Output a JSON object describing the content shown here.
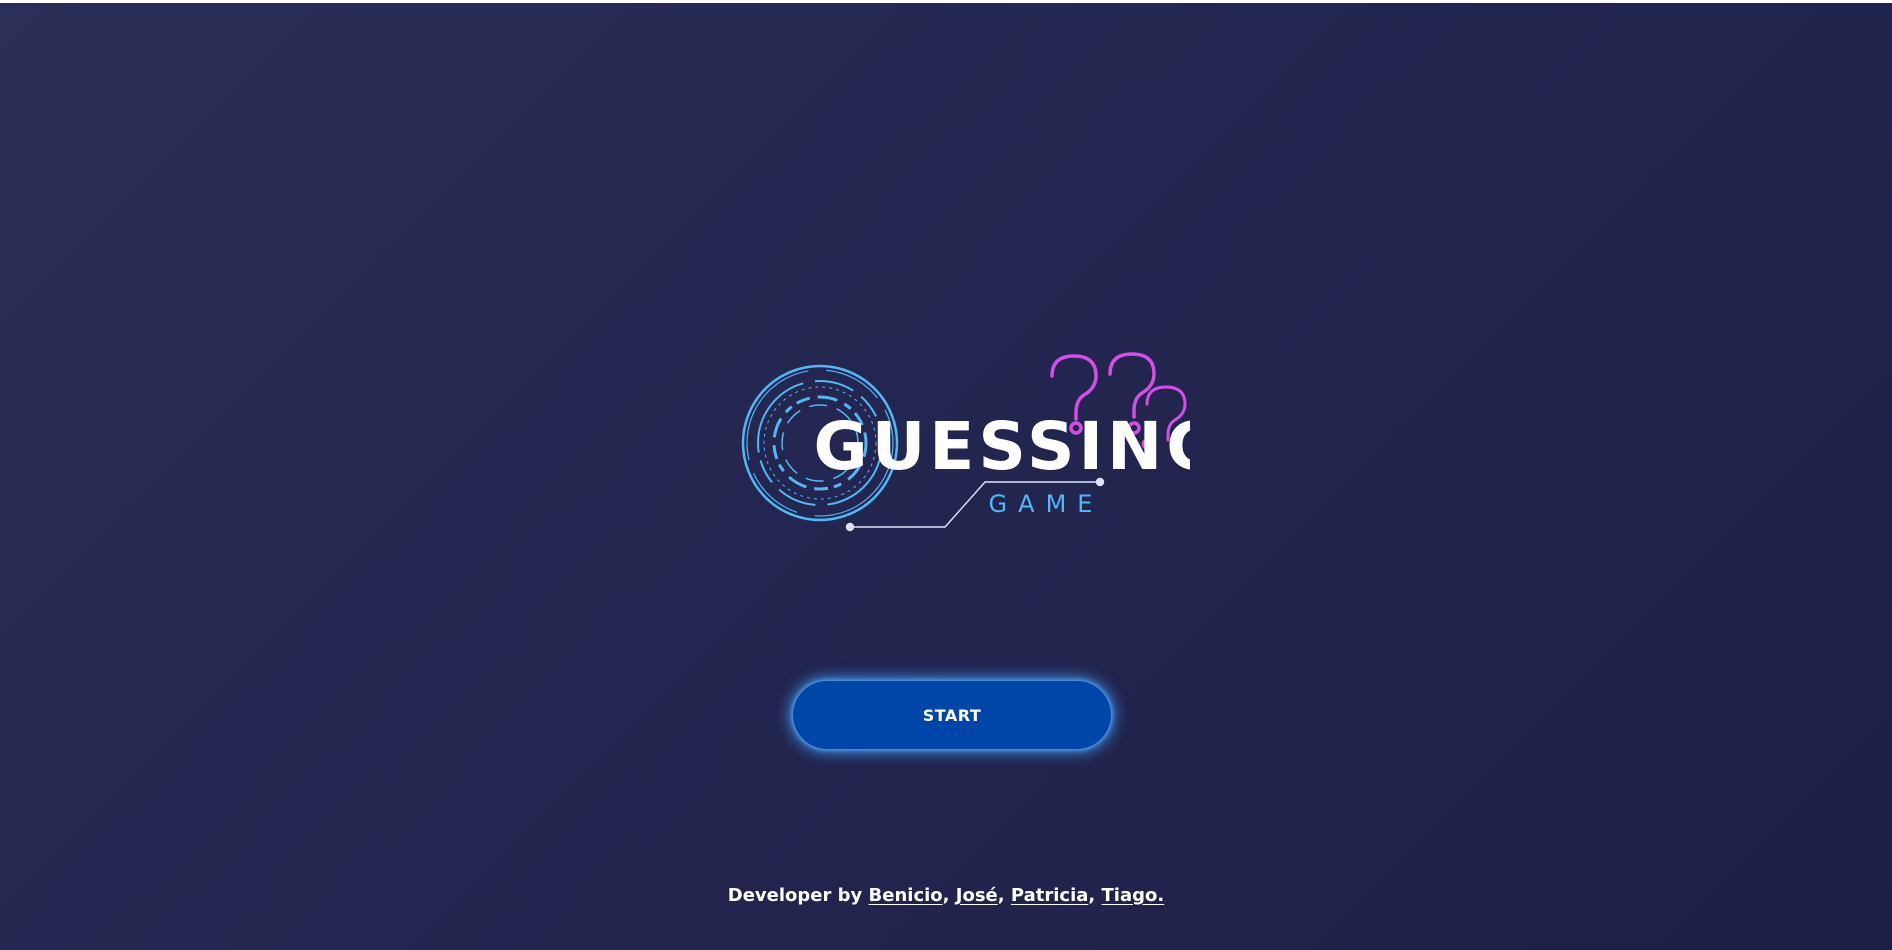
{
  "logo": {
    "title": "GUESSING",
    "subtitle": "GAME",
    "colors": {
      "title": "#ffffff",
      "subtitle": "#4fb8f5",
      "rings": "#4fb8f5",
      "question_marks": "#d24ee6",
      "circuit_line": "#dfe3ff"
    },
    "icons": [
      "target-rings-icon",
      "question-marks-icon"
    ]
  },
  "start_button": {
    "label": "START",
    "color": "#0046a8",
    "glow": "#40a0ff"
  },
  "credits": {
    "prefix": "Developer by",
    "developers": [
      {
        "name": "Benicio",
        "sep": ","
      },
      {
        "name": "José",
        "sep": ","
      },
      {
        "name": "Patricia",
        "sep": ","
      },
      {
        "name": "Tiago.",
        "sep": ""
      }
    ]
  },
  "theme": {
    "background_start": "#2c2f57",
    "background_end": "#1c1f45"
  }
}
